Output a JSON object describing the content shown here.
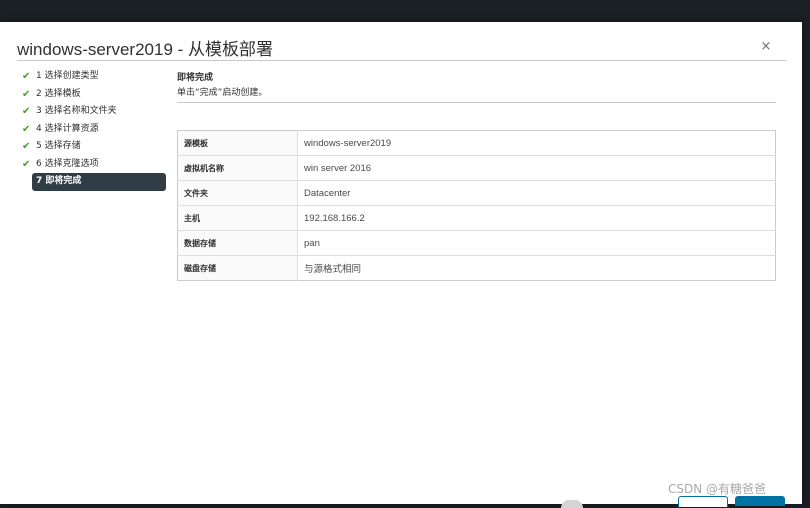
{
  "dialog": {
    "title": "windows-server2019 - 从模板部署",
    "close_label": "×"
  },
  "steps": [
    {
      "label": "1 选择创建类型",
      "completed": true
    },
    {
      "label": "2 选择模板",
      "completed": true
    },
    {
      "label": "3 选择名称和文件夹",
      "completed": true
    },
    {
      "label": "4 选择计算资源",
      "completed": true
    },
    {
      "label": "5 选择存储",
      "completed": true
    },
    {
      "label": "6 选择克隆选项",
      "completed": true
    },
    {
      "label": "7 即将完成",
      "completed": false,
      "active": true
    }
  ],
  "content": {
    "heading": "即将完成",
    "subheading": "单击“完成”启动创建。"
  },
  "summary": [
    {
      "label": "源模板",
      "value": "windows-server2019"
    },
    {
      "label": "虚拟机名称",
      "value": "win server 2016"
    },
    {
      "label": "文件夹",
      "value": "Datacenter"
    },
    {
      "label": "主机",
      "value": "192.168.166.2"
    },
    {
      "label": "数据存储",
      "value": "pan"
    },
    {
      "label": "磁盘存储",
      "value": "与源格式相同"
    }
  ],
  "watermark": "CSDN @有糖爸爸",
  "colors": {
    "check": "#4a9a2e",
    "active_step_bg": "#313d46",
    "primary": "#0072a3"
  }
}
